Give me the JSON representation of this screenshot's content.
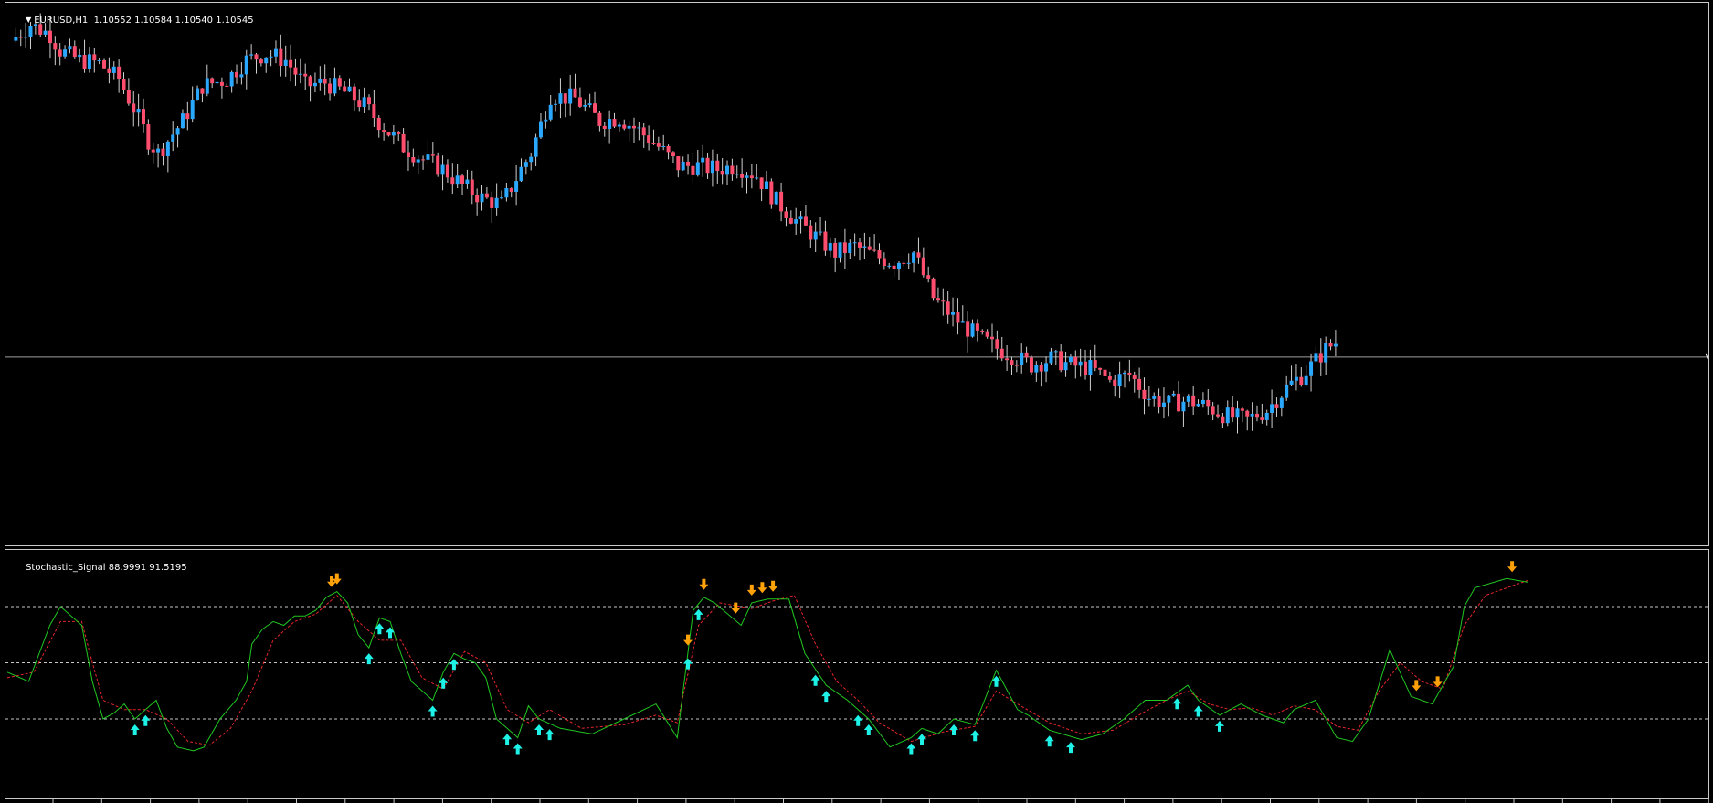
{
  "header": {
    "symbol": "EURUSD,H1",
    "ohlc": "1.10552 1.10584 1.10540 1.10545"
  },
  "indicator": {
    "name": "Stochastic_Signal",
    "values": "88.9991 91.5195",
    "levels": [
      80,
      50,
      20
    ],
    "range": [
      0,
      100
    ]
  },
  "colors": {
    "bull_candle": "#2aa8ff",
    "bear_candle": "#ff4d6d",
    "main_line": "#21c821",
    "signal_line": "#e8262b",
    "buy_arrow": "#1ef2e6",
    "sell_arrow": "#ffa20a",
    "level_line": "#c8c8c8",
    "bid_line": "#a0a0a0",
    "frame": "#c9c9c9"
  },
  "icons": {
    "menu": "dropdown-triangle-icon",
    "buy": "up-arrow-icon",
    "sell": "down-arrow-icon"
  },
  "chart_data": [
    {
      "type": "candlestick",
      "title": "EURUSD,H1",
      "bid": 1.10545,
      "close_path": [
        [
          0,
          1.1153
        ],
        [
          4,
          1.1158
        ],
        [
          8,
          1.1155
        ],
        [
          10,
          1.115
        ],
        [
          14,
          1.1147
        ],
        [
          18,
          1.1146
        ],
        [
          22,
          1.1141
        ],
        [
          26,
          1.1129
        ],
        [
          28,
          1.1122
        ],
        [
          30,
          1.1118
        ],
        [
          35,
          1.1128
        ],
        [
          39,
          1.1139
        ],
        [
          44,
          1.1141
        ],
        [
          48,
          1.1147
        ],
        [
          52,
          1.1149
        ],
        [
          56,
          1.1147
        ],
        [
          60,
          1.1139
        ],
        [
          64,
          1.114
        ],
        [
          68,
          1.1137
        ],
        [
          72,
          1.1133
        ],
        [
          76,
          1.1126
        ],
        [
          80,
          1.112
        ],
        [
          84,
          1.1116
        ],
        [
          88,
          1.1113
        ],
        [
          92,
          1.1108
        ],
        [
          96,
          1.1104
        ],
        [
          100,
          1.1102
        ],
        [
          104,
          1.1113
        ],
        [
          106,
          1.1118
        ],
        [
          110,
          1.1136
        ],
        [
          115,
          1.1135
        ],
        [
          120,
          1.1128
        ],
        [
          124,
          1.1129
        ],
        [
          128,
          1.1125
        ],
        [
          132,
          1.112
        ],
        [
          136,
          1.1114
        ],
        [
          140,
          1.1114
        ],
        [
          144,
          1.1113
        ],
        [
          148,
          1.1114
        ],
        [
          152,
          1.1111
        ],
        [
          156,
          1.1103
        ],
        [
          160,
          1.1097
        ],
        [
          164,
          1.1092
        ],
        [
          168,
          1.1087
        ],
        [
          172,
          1.1089
        ],
        [
          176,
          1.1086
        ],
        [
          180,
          1.1084
        ],
        [
          184,
          1.1087
        ],
        [
          188,
          1.1073
        ],
        [
          192,
          1.1067
        ],
        [
          196,
          1.1062
        ],
        [
          200,
          1.1058
        ],
        [
          204,
          1.1055
        ],
        [
          208,
          1.1052
        ],
        [
          212,
          1.1054
        ],
        [
          216,
          1.1052
        ],
        [
          220,
          1.1051
        ],
        [
          224,
          1.1047
        ],
        [
          228,
          1.1049
        ],
        [
          232,
          1.1042
        ],
        [
          236,
          1.104
        ],
        [
          240,
          1.1041
        ],
        [
          244,
          1.1039
        ],
        [
          248,
          1.1036
        ],
        [
          252,
          1.1035
        ],
        [
          256,
          1.1038
        ],
        [
          260,
          1.1045
        ],
        [
          264,
          1.105
        ],
        [
          268,
          1.1057
        ],
        [
          270,
          1.1059
        ]
      ]
    },
    {
      "type": "line",
      "title": "Stochastic_Signal 88.9991 91.5195",
      "ylim": [
        0,
        100
      ],
      "levels": [
        80,
        50,
        20
      ],
      "series": [
        {
          "color": "main",
          "points": [
            [
              0,
              45
            ],
            [
              4,
              40
            ],
            [
              8,
              70
            ],
            [
              10,
              80
            ],
            [
              14,
              70
            ],
            [
              16,
              40
            ],
            [
              18,
              20
            ],
            [
              20,
              23
            ],
            [
              22,
              28
            ],
            [
              24,
              20
            ],
            [
              26,
              25
            ],
            [
              28,
              30
            ],
            [
              30,
              15
            ],
            [
              32,
              5
            ],
            [
              35,
              3
            ],
            [
              37,
              5
            ],
            [
              40,
              20
            ],
            [
              43,
              30
            ],
            [
              45,
              40
            ],
            [
              46,
              60
            ],
            [
              48,
              68
            ],
            [
              50,
              72
            ],
            [
              52,
              70
            ],
            [
              54,
              75
            ],
            [
              56,
              75
            ],
            [
              58,
              78
            ],
            [
              60,
              85
            ],
            [
              62,
              88
            ],
            [
              64,
              82
            ],
            [
              66,
              65
            ],
            [
              68,
              58
            ],
            [
              70,
              74
            ],
            [
              72,
              72
            ],
            [
              74,
              55
            ],
            [
              76,
              40
            ],
            [
              78,
              35
            ],
            [
              80,
              30
            ],
            [
              82,
              45
            ],
            [
              84,
              55
            ],
            [
              86,
              52
            ],
            [
              88,
              50
            ],
            [
              90,
              42
            ],
            [
              92,
              20
            ],
            [
              94,
              15
            ],
            [
              96,
              10
            ],
            [
              98,
              27
            ],
            [
              100,
              20
            ],
            [
              104,
              15
            ],
            [
              110,
              12
            ],
            [
              116,
              20
            ],
            [
              122,
              28
            ],
            [
              126,
              10
            ],
            [
              129,
              78
            ],
            [
              131,
              85
            ],
            [
              133,
              82
            ],
            [
              138,
              70
            ],
            [
              140,
              82
            ],
            [
              143,
              84
            ],
            [
              147,
              84
            ],
            [
              150,
              55
            ],
            [
              154,
              38
            ],
            [
              158,
              30
            ],
            [
              162,
              20
            ],
            [
              166,
              5
            ],
            [
              170,
              10
            ],
            [
              172,
              15
            ],
            [
              175,
              12
            ],
            [
              178,
              20
            ],
            [
              182,
              17
            ],
            [
              186,
              46
            ],
            [
              190,
              25
            ],
            [
              192,
              22
            ],
            [
              196,
              14
            ],
            [
              202,
              9
            ],
            [
              206,
              12
            ],
            [
              210,
              20
            ],
            [
              214,
              30
            ],
            [
              218,
              30
            ],
            [
              222,
              38
            ],
            [
              224,
              30
            ],
            [
              228,
              22
            ],
            [
              232,
              28
            ],
            [
              236,
              22
            ],
            [
              240,
              18
            ],
            [
              242,
              25
            ],
            [
              246,
              30
            ],
            [
              250,
              10
            ],
            [
              253,
              8
            ],
            [
              256,
              20
            ],
            [
              260,
              57
            ],
            [
              264,
              32
            ],
            [
              268,
              28
            ],
            [
              272,
              48
            ],
            [
              274,
              80
            ],
            [
              276,
              90
            ],
            [
              282,
              95
            ],
            [
              286,
              93
            ]
          ]
        },
        {
          "color": "signal",
          "points": [
            [
              0,
              42
            ],
            [
              5,
              45
            ],
            [
              10,
              72
            ],
            [
              14,
              72
            ],
            [
              16,
              50
            ],
            [
              18,
              30
            ],
            [
              22,
              25
            ],
            [
              26,
              25
            ],
            [
              30,
              20
            ],
            [
              34,
              8
            ],
            [
              38,
              6
            ],
            [
              42,
              15
            ],
            [
              46,
              35
            ],
            [
              50,
              62
            ],
            [
              54,
              72
            ],
            [
              58,
              76
            ],
            [
              62,
              86
            ],
            [
              66,
              72
            ],
            [
              70,
              62
            ],
            [
              74,
              62
            ],
            [
              78,
              42
            ],
            [
              82,
              36
            ],
            [
              86,
              56
            ],
            [
              90,
              50
            ],
            [
              94,
              25
            ],
            [
              98,
              18
            ],
            [
              102,
              25
            ],
            [
              108,
              15
            ],
            [
              116,
              17
            ],
            [
              122,
              22
            ],
            [
              126,
              18
            ],
            [
              130,
              70
            ],
            [
              134,
              82
            ],
            [
              140,
              79
            ],
            [
              144,
              83
            ],
            [
              148,
              86
            ],
            [
              152,
              60
            ],
            [
              156,
              40
            ],
            [
              160,
              30
            ],
            [
              164,
              18
            ],
            [
              170,
              8
            ],
            [
              176,
              13
            ],
            [
              182,
              16
            ],
            [
              186,
              35
            ],
            [
              190,
              28
            ],
            [
              196,
              18
            ],
            [
              202,
              12
            ],
            [
              208,
              14
            ],
            [
              214,
              24
            ],
            [
              218,
              30
            ],
            [
              222,
              35
            ],
            [
              226,
              28
            ],
            [
              230,
              25
            ],
            [
              234,
              26
            ],
            [
              238,
              22
            ],
            [
              242,
              27
            ],
            [
              246,
              25
            ],
            [
              250,
              16
            ],
            [
              254,
              14
            ],
            [
              258,
              35
            ],
            [
              262,
              50
            ],
            [
              266,
              40
            ],
            [
              270,
              36
            ],
            [
              274,
              70
            ],
            [
              278,
              86
            ],
            [
              282,
              90
            ],
            [
              286,
              94
            ]
          ]
        }
      ],
      "buy_signals": [
        24,
        26,
        68,
        70,
        72,
        80,
        82,
        84,
        94,
        96,
        100,
        102,
        128,
        130,
        152,
        154,
        160,
        162,
        170,
        172,
        178,
        182,
        186,
        196,
        200,
        220,
        224,
        228
      ],
      "sell_signals": [
        61,
        62,
        128,
        131,
        137,
        140,
        142,
        144,
        265,
        269,
        283
      ]
    }
  ]
}
